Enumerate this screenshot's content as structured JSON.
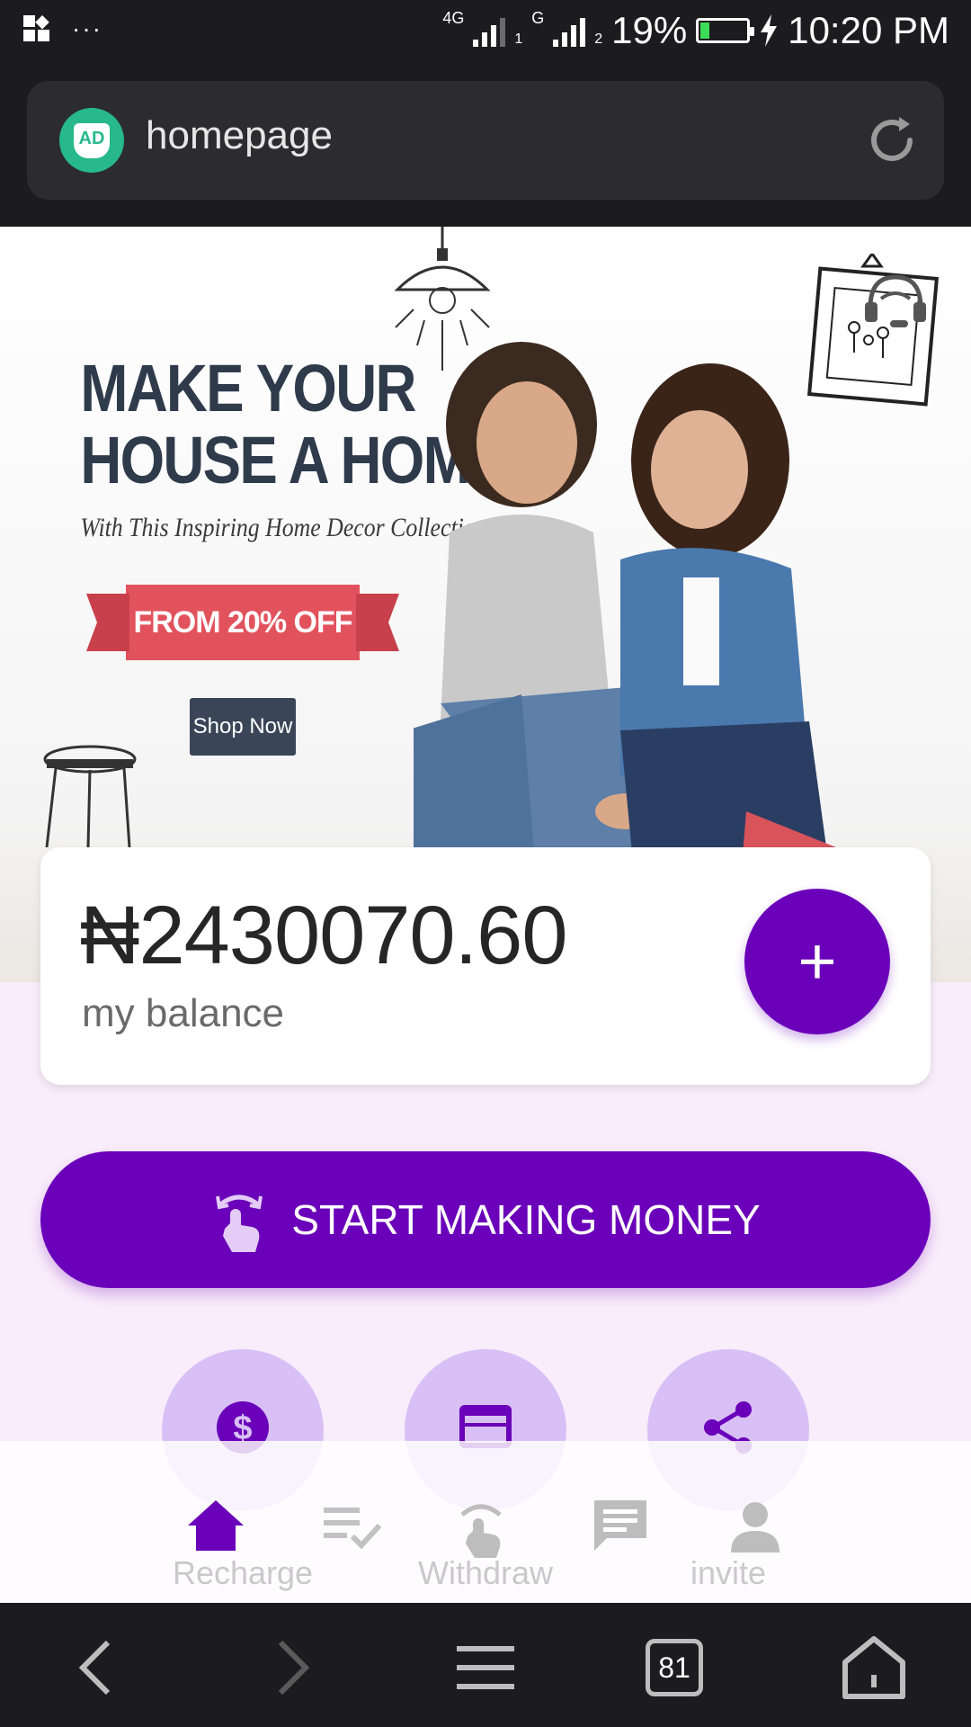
{
  "status_bar": {
    "network_1": "4G",
    "sim_1": "1",
    "network_2": "G",
    "sim_2": "2",
    "battery_percent": "19%",
    "battery_level": 0.19,
    "time": "10:20 PM"
  },
  "browser": {
    "address_badge": "AD",
    "address_text": "homepage",
    "tab_count": "81"
  },
  "banner": {
    "title_line1": "MAKE YOUR",
    "title_line2": "HOUSE A HOME",
    "subtitle": "With This Inspiring Home Decor Collection",
    "discount": "FROM 20% OFF",
    "shop_button": "Shop Now"
  },
  "balance": {
    "amount": "₦2430070.60",
    "label": "my balance",
    "add_symbol": "+"
  },
  "cta": {
    "label": "START MAKING MONEY"
  },
  "actions": [
    {
      "icon": "dollar-icon"
    },
    {
      "icon": "credit-card-icon"
    },
    {
      "icon": "share-icon"
    }
  ],
  "tabbar": {
    "labels": [
      "Recharge",
      "Withdraw",
      "invite"
    ],
    "icons": [
      "home-icon",
      "task-list-icon",
      "tap-icon",
      "message-icon",
      "person-icon"
    ]
  },
  "colors": {
    "accent": "#6a00b9",
    "accent_light": "#d8bff5",
    "page_bg": "#f9ecfb",
    "bar_bg": "#1c1c1e"
  }
}
